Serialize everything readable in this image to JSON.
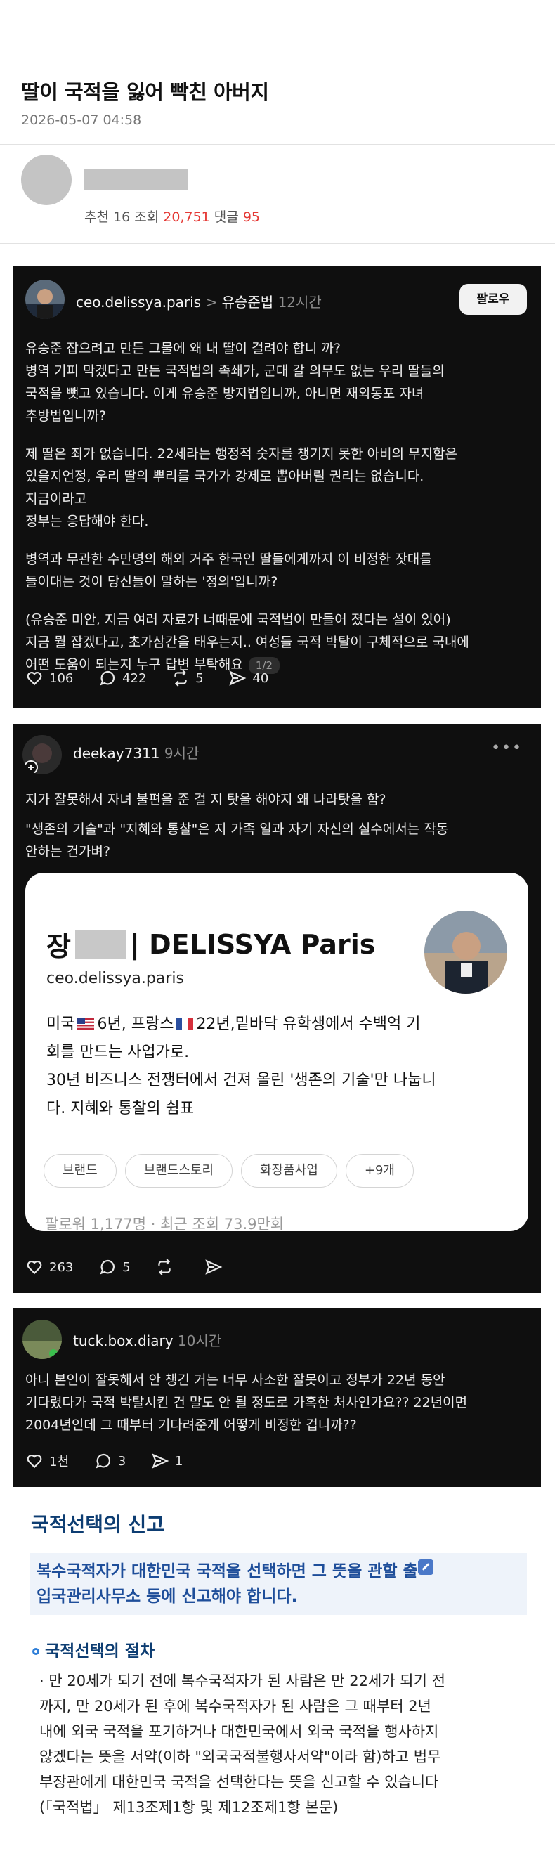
{
  "article": {
    "title": "딸이 국적을 잃어 빡친 아버지",
    "datetime": "2026-05-07 04:58",
    "stats": {
      "recommend_label": "추천",
      "recommend": "16",
      "views_label": "조회",
      "views": "20,751",
      "comments_label": "댓글",
      "comments": "95"
    }
  },
  "post1": {
    "username": "ceo.delissya.paris",
    "sep": ">",
    "topic": "유승준법",
    "time": "12시간",
    "follow_label": "팔로우",
    "lines": [
      "유승준 잡으려고 만든 그물에 왜 내 딸이 걸려야 합니 까?",
      "병역 기피 막겠다고 만든 국적법의 족쇄가, 군대 갈 의무도 없는 우리 딸들의",
      "국적을 뺏고 있습니다. 이게 유승준 방지법입니까, 아니면 재외동포 자녀",
      "추방법입니까?",
      "",
      "제 딸은 죄가 없습니다. 22세라는 행정적 숫자를 챙기지 못한 아비의 무지함은",
      "있을지언정, 우리 딸의 뿌리를 국가가 강제로 뽑아버릴 권리는 없습니다.",
      "지금이라고",
      "정부는 응답해야 한다.",
      "",
      "병역과 무관한 수만명의 해외 거주 한국인 딸들에게까지 이 비정한 잣대를",
      "들이대는 것이 당신들이 말하는 '정의'입니까?",
      "",
      "(유승준 미안, 지금 여러 자료가 너때문에 국적법이 만들어 졌다는 설이 있어)",
      "지금 뭘 잡겠다고, 초가삼간을 태우는지.. 여성들 국적 박탈이 구체적으로 국내에",
      "어떤 도움이  되는지 누구 답변 부탁해요"
    ],
    "page_indicator": "1/2",
    "likes": "106",
    "replies": "422",
    "reposts": "5",
    "shares": "40"
  },
  "post2": {
    "username": "deekay7311",
    "time": "9시간",
    "lines": [
      "지가 잘못해서 자녀 불편을 준 걸 지 탓을 해야지 왜 나라탓을 함?",
      "",
      "\"생존의 기술\"과 \"지혜와 통찰\"은 지 가족 일과 자기 자신의 실수에서는 작동",
      "안하는 건가벼?"
    ],
    "profile": {
      "name_prefix": "장",
      "name_suffix": "| DELISSYA Paris",
      "handle": "ceo.delissya.paris",
      "bio_line1_a": "미국",
      "bio_line1_b": "6년, 프랑스",
      "bio_line1_c": "22년,밑바닥 유학생에서 수백억 기",
      "bio_line2": "회를 만드는 사업가로.",
      "bio_line3": "30년 비즈니스 전쟁터에서 건져 올린 '생존의 기술'만 나눕니",
      "bio_line4": "다. 지혜와 통찰의 쉼표",
      "tags": [
        "브랜드",
        "브랜드스토리",
        "화장품사업",
        "+9개"
      ],
      "footer": "팔로워 1,177명 · 최근 조회 73.9만회"
    },
    "likes": "263",
    "replies": "5"
  },
  "post3": {
    "username": "tuck.box.diary",
    "time": "10시간",
    "lines": [
      "아니 본인이 잘못해서 안 챙긴 거는 너무 사소한 잘못이고 정부가 22년 동안",
      "기다렸다가 국적 박탈시킨 건 말도 안 될 정도로 가혹한 처사인가요?? 22년이면",
      "2004년인데 그 때부터 기다려준게 어떻게 비정한 겁니까??"
    ],
    "likes": "1천",
    "replies": "3",
    "shares": "1"
  },
  "legal": {
    "title": "국적선택의 신고",
    "box_line1": "복수국적자가 대한민국 국적을 선택하면 그 뜻을 관할 출",
    "box_line2": "입국관리사무소 등에 신고해야 합니다.",
    "subtitle": "국적선택의 절차",
    "body": [
      "· 만 20세가 되기 전에 복수국적자가 된 사람은 만 22세가 되기 전",
      "까지, 만 20세가 된 후에 복수국적자가 된 사람은 그 때부터 2년",
      "내에 외국 국적을 포기하거나 대한민국에서 외국 국적을 행사하지",
      "않겠다는 뜻을 서약(이하 \"외국국적불행사서약\"이라 함)하고 법무",
      "부장관에게 대한민국 국적을 선택한다는 뜻을 신고할 수 있습니다",
      "(「국적법」 제13조제1항 및 제12조제1항 본문)"
    ]
  },
  "colors": {
    "accent_red": "#e53935",
    "legal_blue": "#1e4e9a",
    "post_bg": "#0f0f0f"
  },
  "icons": [
    "heart-icon",
    "comment-icon",
    "repost-icon",
    "share-icon",
    "more-icon",
    "edit-icon",
    "flag-us-icon",
    "flag-fr-icon"
  ]
}
